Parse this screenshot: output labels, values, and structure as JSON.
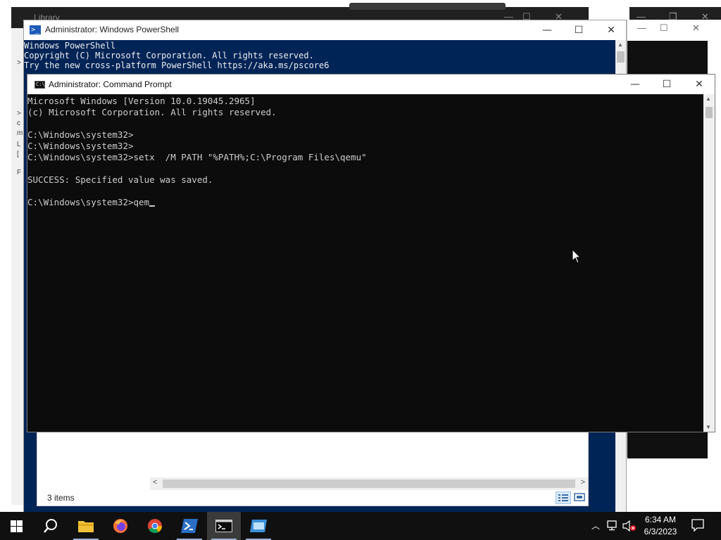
{
  "background_windows": {
    "library_title": "Library",
    "left_panel_glyphs": [
      ">",
      ">",
      "c",
      "m",
      "L",
      "[",
      "F"
    ]
  },
  "explorer": {
    "status_text": "3 items"
  },
  "powershell": {
    "title": "Administrator: Windows PowerShell",
    "lines": [
      "Windows PowerShell",
      "Copyright (C) Microsoft Corporation. All rights reserved.",
      "",
      "Try the new cross-platform PowerShell https://aka.ms/pscore6"
    ]
  },
  "cmd": {
    "title": "Administrator:  Command Prompt",
    "lines": [
      "Microsoft Windows [Version 10.0.19045.2965]",
      "(c) Microsoft Corporation. All rights reserved.",
      "",
      "C:\\Windows\\system32>",
      "C:\\Windows\\system32>",
      "C:\\Windows\\system32>setx  /M PATH \"%PATH%;C:\\Program Files\\qemu\"",
      "",
      "SUCCESS: Specified value was saved.",
      ""
    ],
    "prompt": "C:\\Windows\\system32>",
    "input": "qem"
  },
  "window_controls": {
    "minimize": "—",
    "maximize": "☐",
    "close": "✕"
  },
  "taskbar": {
    "apps": [
      {
        "name": "start",
        "icon": "windows-logo-icon"
      },
      {
        "name": "search",
        "icon": "search-icon"
      },
      {
        "name": "file-explorer",
        "icon": "folder-icon"
      },
      {
        "name": "firefox",
        "icon": "firefox-icon"
      },
      {
        "name": "chrome",
        "icon": "chrome-icon"
      },
      {
        "name": "powershell",
        "icon": "powershell-icon"
      },
      {
        "name": "command-prompt",
        "icon": "cmd-icon",
        "active": true
      },
      {
        "name": "remote-desktop",
        "icon": "window-app-icon"
      }
    ],
    "time": "6:34 AM",
    "date": "6/3/2023"
  },
  "colors": {
    "powershell_bg": "#012456",
    "cmd_bg": "#0c0c0c",
    "cmd_text": "#cccccc",
    "taskbar_bg": "#101010"
  }
}
